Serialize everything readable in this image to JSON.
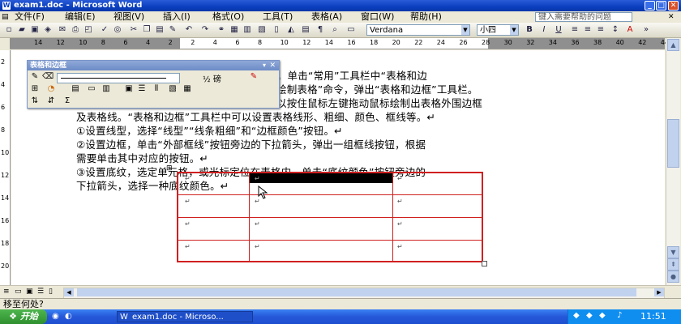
{
  "window": {
    "title": "exam1.doc - Microsoft Word",
    "min": "_",
    "max": "□",
    "close": "✕"
  },
  "menu": {
    "items": [
      "文件(F)",
      "编辑(E)",
      "视图(V)",
      "插入(I)",
      "格式(O)",
      "工具(T)",
      "表格(A)",
      "窗口(W)",
      "帮助(H)"
    ],
    "help_placeholder": "键入需要帮助的问题",
    "close": "✕"
  },
  "toolbar": {
    "font_name": "Verdana",
    "font_size": "小四",
    "bold": "B",
    "italic": "I",
    "underline": "U",
    "font_color": "A"
  },
  "ruler": {
    "h_numbers": [
      "14",
      "12",
      "10",
      "8",
      "6",
      "4",
      "2",
      "2",
      "4",
      "6",
      "8",
      "10",
      "12",
      "14",
      "16",
      "18",
      "20",
      "22",
      "24",
      "26",
      "28",
      "30",
      "32",
      "34",
      "36",
      "38",
      "40",
      "42",
      "44"
    ],
    "v_numbers": [
      "2",
      "4",
      "6",
      "8",
      "10",
      "12",
      "14",
      "16",
      "18",
      "20"
    ]
  },
  "document": {
    "lines": [
      "绘制表格。单击“常用”工具栏中“表格和边",
      "绘制表格”命令，弹出“表格和边框”工具栏。",
      "以按住鼠标左键拖动鼠标绘制出表格外围边框",
      "及表格线。“表格和边框”工具栏中可以设置表格线形、粗细、颜色、框线等。↵",
      "①设置线型，选择“线型”“线条粗细”和“边框颜色”按钮。↵",
      "②设置边框，单击“外部框线”按钮旁边的下拉箭头，弹出一组框线按钮，根据",
      "需要单击其中对应的按钮。↵",
      "③设置底纹，选定单元格，或光标定位在表格内，单击“底纹颜色”按钮旁边的",
      "下拉箭头，选择一种底纹颜色。↵"
    ],
    "cell_mark": "↵"
  },
  "floating_toolbar": {
    "title": "表格和边框",
    "line_weight": "½ 磅",
    "sum": "Σ"
  },
  "status": {
    "text": "移至何处?"
  },
  "taskbar": {
    "start": "开始",
    "item": "exam1.doc - Microso...",
    "clock": "11:51"
  },
  "colors": {
    "table_border": "#d02020",
    "title_bar": "#0a3fbf"
  }
}
